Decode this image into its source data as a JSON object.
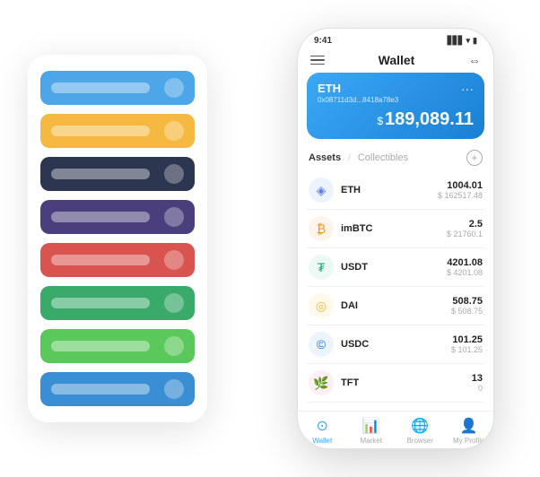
{
  "scene": {
    "left_panel": {
      "cards": [
        {
          "color": "#4da6e8",
          "label": ""
        },
        {
          "color": "#f5b942",
          "label": ""
        },
        {
          "color": "#2d3650",
          "label": ""
        },
        {
          "color": "#4a3f7c",
          "label": ""
        },
        {
          "color": "#d9534f",
          "label": ""
        },
        {
          "color": "#3aaa6a",
          "label": ""
        },
        {
          "color": "#5bc85b",
          "label": ""
        },
        {
          "color": "#3a8fd4",
          "label": ""
        }
      ]
    },
    "phone": {
      "status_bar": {
        "time": "9:41",
        "signal": "▋▋▋",
        "wifi": "▾",
        "battery": "▮"
      },
      "header": {
        "title": "Wallet"
      },
      "eth_card": {
        "symbol": "ETH",
        "address": "0x08711d3d...8418a78e3",
        "amount": "189,089.11",
        "dollar_sign": "$"
      },
      "assets_section": {
        "tab_active": "Assets",
        "tab_separator": "/",
        "tab_inactive": "Collectibles"
      },
      "assets": [
        {
          "symbol": "ETH",
          "icon": "◈",
          "icon_class": "icon-eth",
          "amount": "1004.01",
          "usd": "$ 162517.48"
        },
        {
          "symbol": "imBTC",
          "icon": "₿",
          "icon_class": "icon-imbtc",
          "amount": "2.5",
          "usd": "$ 21760.1"
        },
        {
          "symbol": "USDT",
          "icon": "₮",
          "icon_class": "icon-usdt",
          "amount": "4201.08",
          "usd": "$ 4201.08"
        },
        {
          "symbol": "DAI",
          "icon": "◎",
          "icon_class": "icon-dai",
          "amount": "508.75",
          "usd": "$ 508.75"
        },
        {
          "symbol": "USDC",
          "icon": "©",
          "icon_class": "icon-usdc",
          "amount": "101.25",
          "usd": "$ 101.25"
        },
        {
          "symbol": "TFT",
          "icon": "🌿",
          "icon_class": "icon-tft",
          "amount": "13",
          "usd": "0"
        }
      ],
      "bottom_nav": [
        {
          "label": "Wallet",
          "icon": "⊙",
          "active": true
        },
        {
          "label": "Market",
          "icon": "📊",
          "active": false
        },
        {
          "label": "Browser",
          "icon": "🌐",
          "active": false
        },
        {
          "label": "My Profile",
          "icon": "👤",
          "active": false
        }
      ]
    }
  }
}
